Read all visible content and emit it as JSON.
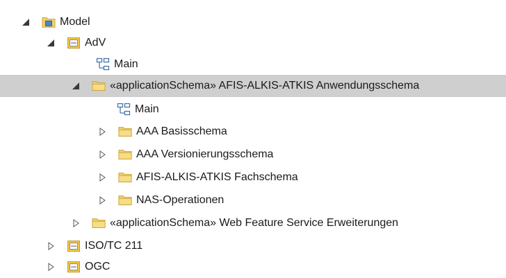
{
  "tree": {
    "nodes": [
      {
        "label": "Model",
        "icon": "model-root-icon",
        "expander": "expanded"
      },
      {
        "label": "AdV",
        "icon": "package-icon",
        "expander": "expanded"
      },
      {
        "label": "Main",
        "icon": "diagram-icon",
        "expander": "none"
      },
      {
        "label": "«applicationSchema» AFIS-ALKIS-ATKIS Anwendungsschema",
        "icon": "folder-icon",
        "expander": "expanded"
      },
      {
        "label": "Main",
        "icon": "diagram-icon",
        "expander": "none"
      },
      {
        "label": "AAA Basisschema",
        "icon": "folder-icon",
        "expander": "collapsed"
      },
      {
        "label": "AAA Versionierungsschema",
        "icon": "folder-icon",
        "expander": "collapsed"
      },
      {
        "label": "AFIS-ALKIS-ATKIS Fachschema",
        "icon": "folder-icon",
        "expander": "collapsed"
      },
      {
        "label": "NAS-Operationen",
        "icon": "folder-icon",
        "expander": "collapsed"
      },
      {
        "label": "«applicationSchema» Web Feature Service Erweiterungen",
        "icon": "folder-icon",
        "expander": "collapsed"
      },
      {
        "label": "ISO/TC 211",
        "icon": "package-icon",
        "expander": "collapsed"
      },
      {
        "label": "OGC",
        "icon": "package-icon",
        "expander": "collapsed"
      }
    ]
  },
  "colors": {
    "selection": "#cfcfcf",
    "folder": "#f2d06b",
    "package": "#f0c84a",
    "diagram": "#3b6ea8"
  }
}
